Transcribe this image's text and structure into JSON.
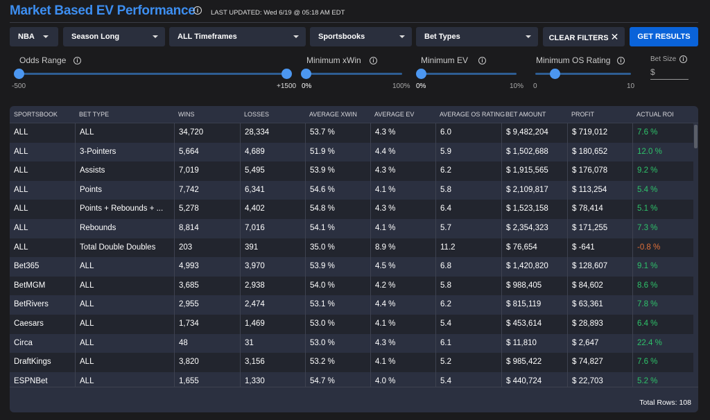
{
  "header": {
    "title": "Market Based EV Performance",
    "last_updated": "LAST UPDATED: Wed 6/19 @ 05:18 AM EDT"
  },
  "filters": {
    "league": "NBA",
    "season": "Season Long",
    "timeframe": "ALL Timeframes",
    "sportsbooks": "Sportsbooks",
    "bet_types": "Bet Types",
    "clear_label": "CLEAR FILTERS",
    "get_label": "GET RESULTS",
    "accent": "#0a63d9"
  },
  "sliders": {
    "odds": {
      "label": "Odds Range",
      "min": "-500",
      "max": "+1500",
      "value": [
        -500,
        1500
      ]
    },
    "xwin": {
      "label": "Minimum xWin",
      "min": "0%",
      "max": "100%",
      "value": 0
    },
    "ev": {
      "label": "Minimum EV",
      "min": "0%",
      "max": "10%",
      "value": 0
    },
    "os": {
      "label": "Minimum OS Rating",
      "min": "0",
      "max": "10",
      "value": 2
    }
  },
  "bet_size": {
    "label": "Bet Size",
    "prefix": "$",
    "value": ""
  },
  "table": {
    "columns": [
      "SPORTSBOOK",
      "BET TYPE",
      "WINS",
      "LOSSES",
      "AVERAGE XWIN",
      "AVERAGE EV",
      "AVERAGE OS RATING",
      "BET AMOUNT",
      "PROFIT",
      "ACTUAL ROI"
    ],
    "rows": [
      [
        "ALL",
        "ALL",
        "34,720",
        "28,334",
        "53.7 %",
        "4.3 %",
        "6.0",
        "$ 9,482,204",
        "$ 719,012",
        "7.6 %"
      ],
      [
        "ALL",
        "3-Pointers",
        "5,664",
        "4,689",
        "51.9 %",
        "4.4 %",
        "5.9",
        "$ 1,502,688",
        "$ 180,652",
        "12.0 %"
      ],
      [
        "ALL",
        "Assists",
        "7,019",
        "5,495",
        "53.9 %",
        "4.3 %",
        "6.2",
        "$ 1,915,565",
        "$ 176,078",
        "9.2 %"
      ],
      [
        "ALL",
        "Points",
        "7,742",
        "6,341",
        "54.6 %",
        "4.1 %",
        "5.8",
        "$ 2,109,817",
        "$ 113,254",
        "5.4 %"
      ],
      [
        "ALL",
        "Points + Rebounds + ...",
        "5,278",
        "4,402",
        "54.8 %",
        "4.3 %",
        "6.4",
        "$ 1,523,158",
        "$ 78,414",
        "5.1 %"
      ],
      [
        "ALL",
        "Rebounds",
        "8,814",
        "7,016",
        "54.1 %",
        "4.1 %",
        "5.7",
        "$ 2,354,323",
        "$ 171,255",
        "7.3 %"
      ],
      [
        "ALL",
        "Total Double Doubles",
        "203",
        "391",
        "35.0 %",
        "8.9 %",
        "11.2",
        "$ 76,654",
        "$ -641",
        "-0.8 %"
      ],
      [
        "Bet365",
        "ALL",
        "4,993",
        "3,970",
        "53.9 %",
        "4.5 %",
        "6.8",
        "$ 1,420,820",
        "$ 128,607",
        "9.1 %"
      ],
      [
        "BetMGM",
        "ALL",
        "3,685",
        "2,938",
        "54.0 %",
        "4.2 %",
        "5.8",
        "$ 988,405",
        "$ 84,602",
        "8.6 %"
      ],
      [
        "BetRivers",
        "ALL",
        "2,955",
        "2,474",
        "53.1 %",
        "4.4 %",
        "6.2",
        "$ 815,119",
        "$ 63,361",
        "7.8 %"
      ],
      [
        "Caesars",
        "ALL",
        "1,734",
        "1,469",
        "53.0 %",
        "4.1 %",
        "5.4",
        "$ 453,614",
        "$ 28,893",
        "6.4 %"
      ],
      [
        "Circa",
        "ALL",
        "48",
        "31",
        "53.0 %",
        "4.3 %",
        "6.1",
        "$ 11,810",
        "$ 2,647",
        "22.4 %"
      ],
      [
        "DraftKings",
        "ALL",
        "3,820",
        "3,156",
        "53.2 %",
        "4.1 %",
        "5.2",
        "$ 985,422",
        "$ 74,827",
        "7.6 %"
      ],
      [
        "ESPNBet",
        "ALL",
        "1,655",
        "1,330",
        "54.7 %",
        "4.0 %",
        "5.4",
        "$ 440,724",
        "$ 22,703",
        "5.2 %"
      ]
    ],
    "positive_color": "#2ec26a",
    "negative_color": "#e0703a",
    "total_rows": "Total Rows: 108"
  }
}
